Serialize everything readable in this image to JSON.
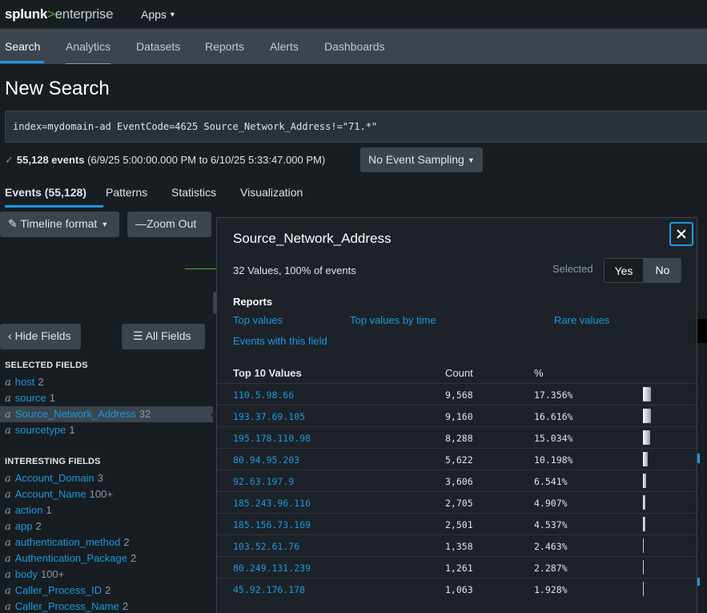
{
  "app": {
    "logo_main": "splunk",
    "logo_gt": ">",
    "logo_sub": "enterprise",
    "apps_label": "Apps"
  },
  "nav": {
    "items": [
      "Search",
      "Analytics",
      "Datasets",
      "Reports",
      "Alerts",
      "Dashboards"
    ],
    "active": "Search"
  },
  "page": {
    "title": "New Search",
    "query": "index=mydomain-ad EventCode=4625 Source_Network_Address!=\"71.*\""
  },
  "status": {
    "event_count": "55,128 events",
    "time_range": "(6/9/25 5:00:00.000 PM to 6/10/25 5:33:47.000 PM)",
    "sampling_label": "No Event Sampling"
  },
  "tabs": [
    "Events (55,128)",
    "Patterns",
    "Statistics",
    "Visualization"
  ],
  "toolbar": {
    "timeline_format": "Timeline format",
    "zoom_out": "Zoom Out",
    "hide_fields": "Hide Fields",
    "all_fields": "All Fields"
  },
  "sidebar": {
    "selected_header": "SELECTED FIELDS",
    "selected": [
      {
        "type": "a",
        "name": "host",
        "count": "2"
      },
      {
        "type": "a",
        "name": "source",
        "count": "1"
      },
      {
        "type": "a",
        "name": "Source_Network_Address",
        "count": "32"
      },
      {
        "type": "a",
        "name": "sourcetype",
        "count": "1"
      }
    ],
    "interesting_header": "INTERESTING FIELDS",
    "interesting": [
      {
        "type": "a",
        "name": "Account_Domain",
        "count": "3"
      },
      {
        "type": "a",
        "name": "Account_Name",
        "count": "100+"
      },
      {
        "type": "a",
        "name": "action",
        "count": "1"
      },
      {
        "type": "a",
        "name": "app",
        "count": "2"
      },
      {
        "type": "a",
        "name": "authentication_method",
        "count": "2"
      },
      {
        "type": "a",
        "name": "Authentication_Package",
        "count": "2"
      },
      {
        "type": "a",
        "name": "body",
        "count": "100+"
      },
      {
        "type": "a",
        "name": "Caller_Process_ID",
        "count": "2"
      },
      {
        "type": "a",
        "name": "Caller_Process_Name",
        "count": "2"
      }
    ]
  },
  "panel": {
    "title": "Source_Network_Address",
    "summary": "32 Values, 100% of events",
    "selected_label": "Selected",
    "yes_label": "Yes",
    "no_label": "No",
    "selected_value": "No",
    "reports_header": "Reports",
    "links": [
      "Top values",
      "Top values by time",
      "Rare values",
      "Events with this field"
    ],
    "table_headers": [
      "Top 10 Values",
      "Count",
      "%"
    ],
    "rows": [
      {
        "value": "110.5.98.66",
        "count": "9,568",
        "pct": "17.356%",
        "pct_num": 17.356
      },
      {
        "value": "193.37.69.105",
        "count": "9,160",
        "pct": "16.616%",
        "pct_num": 16.616
      },
      {
        "value": "195.178.110.98",
        "count": "8,288",
        "pct": "15.034%",
        "pct_num": 15.034
      },
      {
        "value": "80.94.95.203",
        "count": "5,622",
        "pct": "10.198%",
        "pct_num": 10.198
      },
      {
        "value": "92.63.197.9",
        "count": "3,606",
        "pct": "6.541%",
        "pct_num": 6.541
      },
      {
        "value": "185.243.96.116",
        "count": "2,705",
        "pct": "4.907%",
        "pct_num": 4.907
      },
      {
        "value": "185.156.73.169",
        "count": "2,501",
        "pct": "4.537%",
        "pct_num": 4.537
      },
      {
        "value": "103.52.61.76",
        "count": "1,358",
        "pct": "2.463%",
        "pct_num": 2.463
      },
      {
        "value": "80.249.131.239",
        "count": "1,261",
        "pct": "2.287%",
        "pct_num": 2.287
      },
      {
        "value": "45.92.176.178",
        "count": "1,063",
        "pct": "1.928%",
        "pct_num": 1.928
      }
    ]
  },
  "colors": {
    "accent": "#1a9ae0",
    "success": "#65a637",
    "background": "#171d21",
    "navbar": "#3c444d"
  }
}
